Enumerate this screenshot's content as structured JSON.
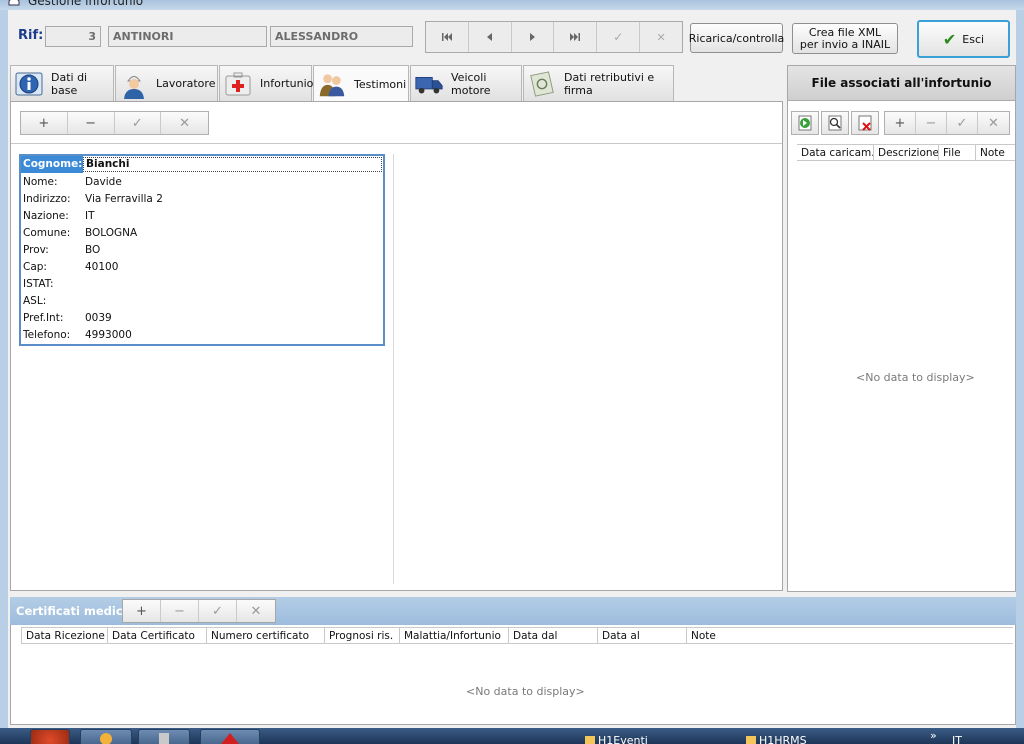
{
  "window": {
    "title": "Gestione infortunio"
  },
  "header": {
    "rif_label": "Rif:",
    "rif_number": "3",
    "surname": "ANTINORI",
    "firstname": "ALESSANDRO",
    "nav": {
      "first_icon": "skip-first-icon",
      "prev_icon": "prev-icon",
      "next_icon": "next-icon",
      "last_icon": "skip-last-icon",
      "confirm_icon": "check-icon",
      "cancel_icon": "close-icon"
    },
    "reload_label": "Ricarica/controlla",
    "xml_label": "Crea file XML per invio a INAIL",
    "exit_label": "Esci"
  },
  "tabs": [
    {
      "label": "Dati di base",
      "icon": "info-icon"
    },
    {
      "label": "Lavoratore",
      "icon": "worker-icon"
    },
    {
      "label": "Infortunio",
      "icon": "first-aid-icon"
    },
    {
      "label": "Testimoni",
      "icon": "people-icon",
      "active": true
    },
    {
      "label": "Veicoli motore",
      "icon": "truck-icon"
    },
    {
      "label": "Dati retributivi e firma",
      "icon": "money-icon"
    }
  ],
  "witness_toolbar": {
    "add": "+",
    "remove": "−",
    "confirm": "✓",
    "cancel": "✕"
  },
  "witness": {
    "rows": [
      {
        "label": "Cognome:",
        "value": "Bianchi"
      },
      {
        "label": "Nome:",
        "value": "Davide"
      },
      {
        "label": "Indirizzo:",
        "value": "Via Ferravilla 2"
      },
      {
        "label": "Nazione:",
        "value": "IT"
      },
      {
        "label": "Comune:",
        "value": "BOLOGNA"
      },
      {
        "label": "Prov:",
        "value": "BO"
      },
      {
        "label": "Cap:",
        "value": "40100"
      },
      {
        "label": "ISTAT:",
        "value": ""
      },
      {
        "label": "ASL:",
        "value": ""
      },
      {
        "label": "Pref.Int:",
        "value": "0039"
      },
      {
        "label": "Telefono:",
        "value": "4993000"
      }
    ]
  },
  "files_panel": {
    "title": "File associati all'infortunio",
    "toolbar": {
      "add": "+",
      "remove": "−",
      "confirm": "✓",
      "cancel": "✕"
    },
    "columns": [
      "Data caricam.",
      "Descrizione",
      "File",
      "Note"
    ],
    "empty_text": "<No data to display>"
  },
  "certificati": {
    "title": "Certificati medici",
    "toolbar": {
      "add": "+",
      "remove": "−",
      "confirm": "✓",
      "cancel": "✕"
    },
    "columns": [
      "Data Ricezione",
      "Data Certificato",
      "Numero certificato",
      "Prognosi ris.",
      "Malattia/Infortunio",
      "Data dal",
      "Data al",
      "Note"
    ],
    "empty_text": "<No data to display>"
  },
  "taskbar": {
    "items": [
      {
        "label": "H1Eventi"
      },
      {
        "label": "H1HRMS"
      },
      {
        "label": "IT"
      }
    ],
    "overflow": "»"
  },
  "colors": {
    "accent": "#3a8ad8",
    "panel_bar": "#9dbcdd",
    "border": "#a7a7a7"
  }
}
